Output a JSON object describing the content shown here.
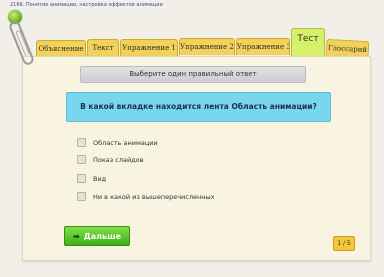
{
  "window": {
    "title": "2166. Понятие анимации, настройка эффектов анимации"
  },
  "tabs": [
    {
      "label": "Объяснение",
      "active": false
    },
    {
      "label": "Текст",
      "active": false
    },
    {
      "label": "Упражнение 1",
      "active": false
    },
    {
      "label": "Упражнение 2",
      "active": false
    },
    {
      "label": "Упражнение 3",
      "active": false
    },
    {
      "label": "Тест",
      "active": true
    },
    {
      "label": "Глоссарий",
      "active": false
    }
  ],
  "quiz": {
    "instruction": "Выберите один правильный ответ",
    "question": "В какой вкладке находится лента Область анимации?",
    "options": [
      {
        "label": "Область анимации",
        "checked": false
      },
      {
        "label": "Показ слайдов",
        "checked": false
      },
      {
        "label": "Вид",
        "checked": false
      },
      {
        "label": "Ни в какой из вышеперечисленных",
        "checked": false
      }
    ],
    "next_label": "Дальше",
    "page_counter": "1 / 5"
  },
  "colors": {
    "tab": "#f2d25a",
    "active_tab": "#d7ef6a",
    "question_bg": "#78d6ef",
    "next_button": "#4fc21f",
    "counter": "#f2c53a"
  }
}
